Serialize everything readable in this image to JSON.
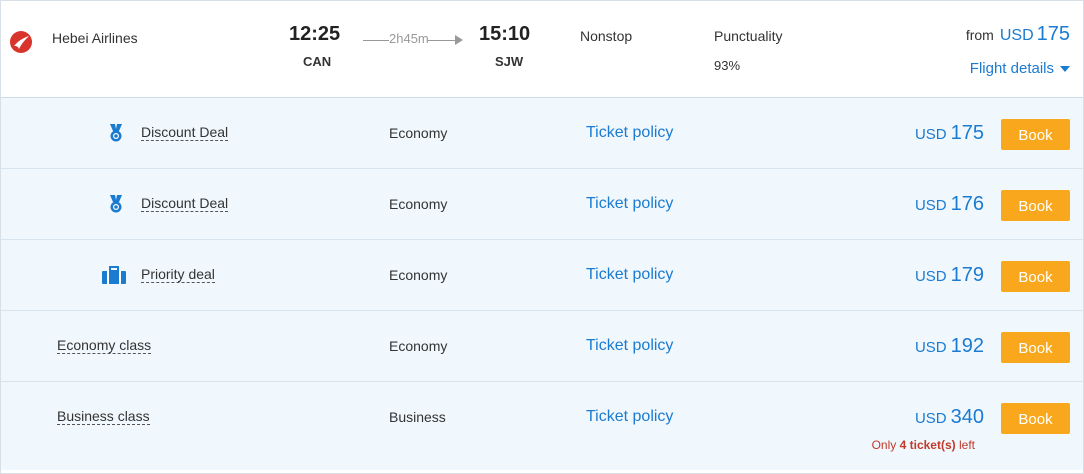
{
  "flight": {
    "airline": "Hebei Airlines",
    "dep_time": "12:25",
    "dep_code": "CAN",
    "duration": "2h45m",
    "arr_time": "15:10",
    "arr_code": "SJW",
    "stops": "Nonstop",
    "punctuality_label": "Punctuality",
    "punctuality_value": "93%",
    "from_label": "from",
    "from_currency": "USD",
    "from_amount": "175",
    "details_label": "Flight details"
  },
  "rows": [
    {
      "deal": "Discount Deal",
      "icon": "medal-icon",
      "cabin": "Economy",
      "policy": "Ticket policy",
      "currency": "USD",
      "amount": "175",
      "book": "Book"
    },
    {
      "deal": "Discount Deal",
      "icon": "medal-icon",
      "cabin": "Economy",
      "policy": "Ticket policy",
      "currency": "USD",
      "amount": "176",
      "book": "Book"
    },
    {
      "deal": "Priority deal",
      "icon": "briefcase-icon",
      "cabin": "Economy",
      "policy": "Ticket policy",
      "currency": "USD",
      "amount": "179",
      "book": "Book"
    },
    {
      "deal": "Economy class",
      "cabin": "Economy",
      "policy": "Ticket policy",
      "currency": "USD",
      "amount": "192",
      "book": "Book"
    },
    {
      "deal": "Business class",
      "cabin": "Business",
      "policy": "Ticket policy",
      "currency": "USD",
      "amount": "340",
      "book": "Book",
      "note_prefix": "Only",
      "note_count": "4 ticket(s)",
      "note_suffix": "left"
    }
  ],
  "colors": {
    "accent": "#1a7bd1",
    "book": "#f9a81d",
    "row_bg": "#f1f8fd",
    "warning": "#c0392b"
  }
}
